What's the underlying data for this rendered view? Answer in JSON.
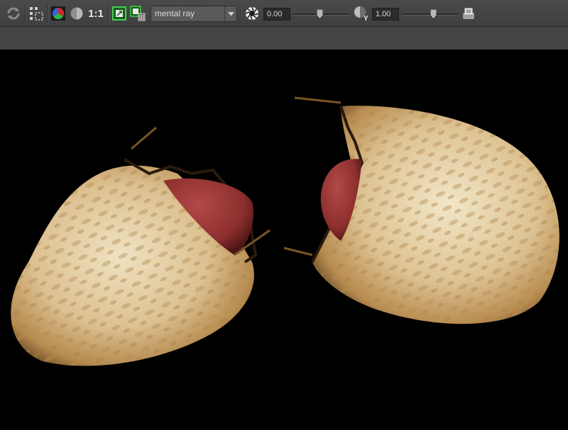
{
  "toolbar": {
    "refresh_icon": "refresh-icon",
    "region_icon": "render-region-icon",
    "rgb_icon": "rgb-channels-icon",
    "alpha_icon": "alpha-channel-icon",
    "ratio_label": "1:1",
    "snapshot_icon": "snapshot-icon",
    "keep_image_icon": "keep-image-icon",
    "renderer": {
      "selected": "mental ray"
    },
    "exposure": {
      "icon": "exposure-icon",
      "value": "0.00",
      "level": 0.48
    },
    "gamma": {
      "icon": "gamma-icon",
      "value": "1.00",
      "level": 0.55
    },
    "settings_icon": "render-settings-icon",
    "colors": {
      "toolbar_bg": "#444444",
      "field_bg": "#2b2b2b",
      "text": "#d8d8d8",
      "viewport_bg": "#000000"
    }
  },
  "viewport": {
    "content": "rendered-image"
  }
}
